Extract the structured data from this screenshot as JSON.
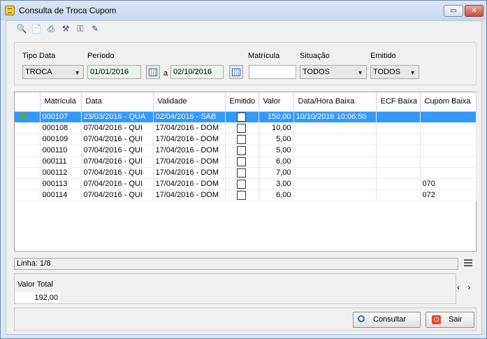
{
  "window": {
    "title": "Consulta de Troca Cupom",
    "max_glyph": "▭",
    "close_glyph": "✕"
  },
  "toolbar": {
    "icons": [
      "search-icon",
      "document-icon",
      "print-icon",
      "tools-icon",
      "key-icon",
      "edit-icon"
    ]
  },
  "filters": {
    "tipo_data_label": "Tipo Data",
    "tipo_data_value": "TROCA",
    "periodo_label": "Período",
    "periodo_from": "01/01/2016",
    "periodo_sep": "a",
    "periodo_to": "02/10/2016",
    "matricula_label": "Matrícula",
    "matricula_value": "",
    "situacao_label": "Situação",
    "situacao_value": "TODOS",
    "emitido_label": "Emitido",
    "emitido_value": "TODOS"
  },
  "grid": {
    "columns": [
      "",
      "Matrícula",
      "Data",
      "Validade",
      "Emitido",
      "Valor",
      "Data/Hora Baixa",
      "ECF Baixa",
      "Cupom Baixa"
    ],
    "rows": [
      {
        "matricula": "000107",
        "data": "23/03/2016 - QUA",
        "validade": "02/04/2016 - SAB",
        "emitido": false,
        "valor": "150,00",
        "baixa": "10/10/2016 10:06:50",
        "ecf": "",
        "cupom": ""
      },
      {
        "matricula": "000108",
        "data": "07/04/2016 - QUI",
        "validade": "17/04/2016 - DOM",
        "emitido": false,
        "valor": "10,00",
        "baixa": "",
        "ecf": "",
        "cupom": ""
      },
      {
        "matricula": "000109",
        "data": "07/04/2016 - QUI",
        "validade": "17/04/2016 - DOM",
        "emitido": false,
        "valor": "5,00",
        "baixa": "",
        "ecf": "",
        "cupom": ""
      },
      {
        "matricula": "000110",
        "data": "07/04/2016 - QUI",
        "validade": "17/04/2016 - DOM",
        "emitido": false,
        "valor": "5,00",
        "baixa": "",
        "ecf": "",
        "cupom": ""
      },
      {
        "matricula": "000111",
        "data": "07/04/2016 - QUI",
        "validade": "17/04/2016 - DOM",
        "emitido": false,
        "valor": "6,00",
        "baixa": "",
        "ecf": "",
        "cupom": ""
      },
      {
        "matricula": "000112",
        "data": "07/04/2016 - QUI",
        "validade": "17/04/2016 - DOM",
        "emitido": false,
        "valor": "7,00",
        "baixa": "",
        "ecf": "",
        "cupom": ""
      },
      {
        "matricula": "000113",
        "data": "07/04/2016 - QUI",
        "validade": "17/04/2016 - DOM",
        "emitido": false,
        "valor": "3,00",
        "baixa": "",
        "ecf": "",
        "cupom": "070"
      },
      {
        "matricula": "000114",
        "data": "07/04/2016 - QUI",
        "validade": "17/04/2016 - DOM",
        "emitido": false,
        "valor": "6,00",
        "baixa": "",
        "ecf": "",
        "cupom": "072"
      }
    ],
    "selected_row": 0,
    "selected_color": "#3399ff"
  },
  "status": {
    "linha": "Linha: 1/8"
  },
  "totals": {
    "label": "Valor Total",
    "value": "192,00",
    "nav": "‹ ›"
  },
  "buttons": {
    "consultar": "Consultar",
    "sair": "Sair"
  }
}
